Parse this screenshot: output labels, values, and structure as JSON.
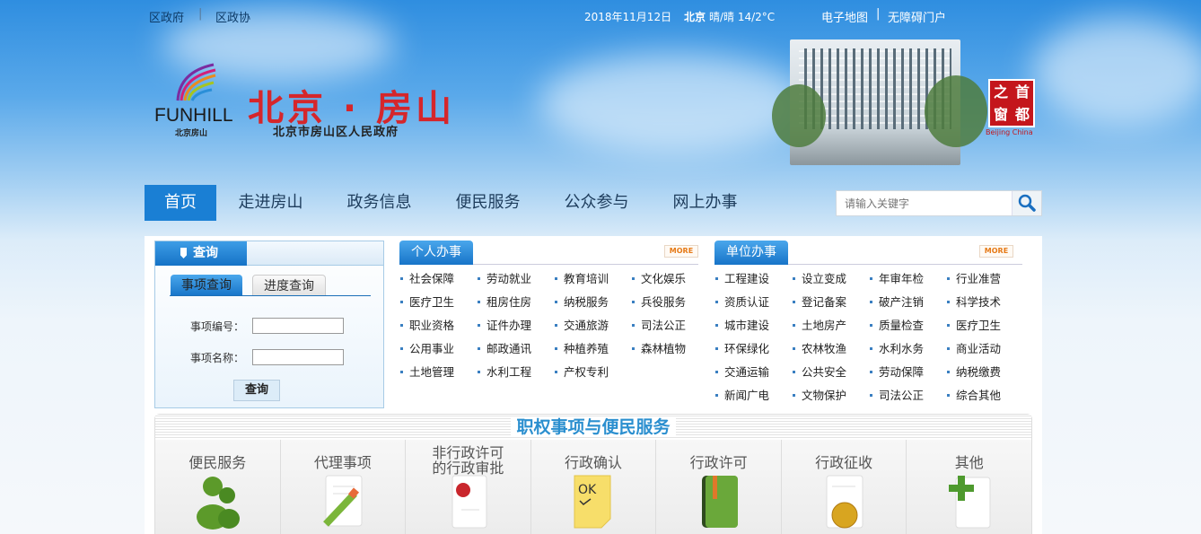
{
  "top": {
    "links": [
      "区政府",
      "区政协"
    ],
    "date": "2018年11月12日",
    "city": "北京",
    "weather": "晴/晴 14/2°C",
    "right_links": [
      "电子地图",
      "无障碍门户"
    ]
  },
  "header": {
    "logo_text": "FUNHILL",
    "logo_sub": "北京房山",
    "title": "北京 · 房山",
    "subtitle": "北京市房山区人民政府",
    "seal_text": "首都之窗",
    "seal_sub": "Beijing China"
  },
  "nav": {
    "items": [
      "首页",
      "走进房山",
      "政务信息",
      "便民服务",
      "公众参与",
      "网上办事"
    ],
    "active": 0,
    "active_color": "#1a7fd4"
  },
  "search": {
    "placeholder": "请输入关键字"
  },
  "query": {
    "title": "查询",
    "tabs": [
      "事项查询",
      "进度查询"
    ],
    "fields": [
      "事项编号：",
      "事项名称："
    ],
    "button": "查询"
  },
  "personal": {
    "title": "个人办事",
    "more": "MORE",
    "items": [
      "社会保障",
      "劳动就业",
      "教育培训",
      "文化娱乐",
      "医疗卫生",
      "租房住房",
      "纳税服务",
      "兵役服务",
      "职业资格",
      "证件办理",
      "交通旅游",
      "司法公正",
      "公用事业",
      "邮政通讯",
      "种植养殖",
      "森林植物",
      "土地管理",
      "水利工程",
      "产权专利"
    ]
  },
  "unit": {
    "title": "单位办事",
    "more": "MORE",
    "items": [
      "工程建设",
      "设立变成",
      "年审年检",
      "行业准营",
      "资质认证",
      "登记备案",
      "破产注销",
      "科学技术",
      "城市建设",
      "土地房产",
      "质量检查",
      "医疗卫生",
      "环保绿化",
      "农林牧渔",
      "水利水务",
      "商业活动",
      "交通运输",
      "公共安全",
      "劳动保障",
      "纳税缴费",
      "新闻广电",
      "文物保护",
      "司法公正",
      "综合其他"
    ]
  },
  "services": {
    "title": "职权事项与便民服务",
    "items": [
      {
        "label": "便民服务",
        "icon": "users-icon"
      },
      {
        "label": "代理事项",
        "icon": "pencil-document-icon"
      },
      {
        "label": "非行政许可的行政审批",
        "icon": "sealed-document-icon"
      },
      {
        "label": "行政确认",
        "icon": "ok-note-icon"
      },
      {
        "label": "行政许可",
        "icon": "green-book-icon"
      },
      {
        "label": "行政征收",
        "icon": "coin-document-icon"
      },
      {
        "label": "其他",
        "icon": "add-document-icon"
      }
    ]
  }
}
